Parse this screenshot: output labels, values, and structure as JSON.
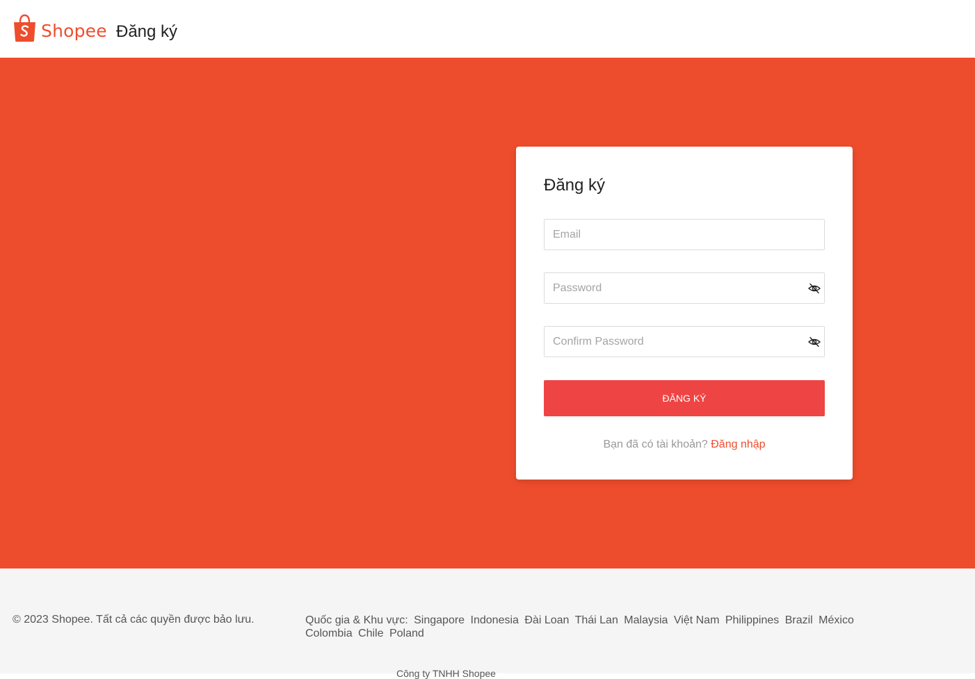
{
  "header": {
    "logo_text": "Shopee",
    "title": "Đăng ký"
  },
  "form": {
    "title": "Đăng ký",
    "email_placeholder": "Email",
    "password_placeholder": "Password",
    "confirm_password_placeholder": "Confirm Password",
    "submit_label": "ĐĂNG KÝ",
    "have_account_text": "Bạn đã có tài khoản?",
    "login_link": "Đăng nhập"
  },
  "footer": {
    "copyright": "© 2023 Shopee. Tất cả các quyền được bảo lưu.",
    "regions_label": "Quốc gia & Khu vực:",
    "regions": [
      "Singapore",
      "Indonesia",
      "Đài Loan",
      "Thái Lan",
      "Malaysia",
      "Việt Nam",
      "Philippines",
      "Brazil",
      "México",
      "Colombia",
      "Chile",
      "Poland"
    ],
    "company": "Công ty TNHH Shopee"
  },
  "colors": {
    "brand": "#ee4d2d",
    "button": "#ef4444"
  },
  "icons": [
    "shopee-bag-icon",
    "eye-off-icon"
  ]
}
